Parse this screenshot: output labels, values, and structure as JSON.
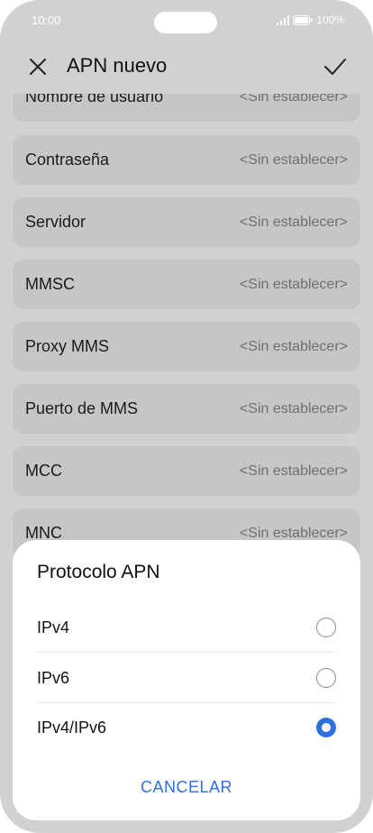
{
  "status_bar": {
    "time": "10:00",
    "battery": "100%"
  },
  "header": {
    "title": "APN nuevo",
    "close_icon": "close-icon",
    "confirm_icon": "check-icon"
  },
  "fields": [
    {
      "label": "Nombre de usuario",
      "value": "<Sin establecer>"
    },
    {
      "label": "Contraseña",
      "value": "<Sin establecer>"
    },
    {
      "label": "Servidor",
      "value": "<Sin establecer>"
    },
    {
      "label": "MMSC",
      "value": "<Sin establecer>"
    },
    {
      "label": "Proxy MMS",
      "value": "<Sin establecer>"
    },
    {
      "label": "Puerto de MMS",
      "value": "<Sin establecer>"
    },
    {
      "label": "MCC",
      "value": "<Sin establecer>"
    },
    {
      "label": "MNC",
      "value": "<Sin establecer>"
    }
  ],
  "dialog": {
    "title": "Protocolo APN",
    "options": [
      {
        "label": "IPv4",
        "selected": false
      },
      {
        "label": "IPv6",
        "selected": false
      },
      {
        "label": "IPv4/IPv6",
        "selected": true
      }
    ],
    "cancel_label": "CANCELAR"
  },
  "colors": {
    "accent": "#2f6fe0",
    "scrim_bg": "#d1d1d1",
    "row_bg": "#c6c6c6"
  }
}
